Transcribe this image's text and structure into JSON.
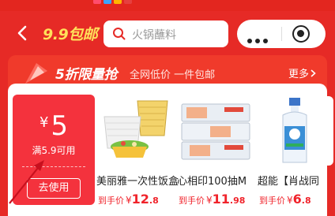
{
  "header": {
    "back_label": "返回",
    "title": "9.9包邮",
    "search_placeholder": "火锅蘸料"
  },
  "banner": {
    "title": "5折限量抢",
    "subtitle": "全网低价  一件包邮",
    "more_label": "更多"
  },
  "coupon": {
    "currency": "¥",
    "amount": "5",
    "condition": "满5.9可用",
    "action_label": "去使用"
  },
  "products": [
    {
      "name": "美丽雅一次性饭盒",
      "price_label": "到手价",
      "currency": "¥",
      "price_int": "12",
      "price_dec": ".8"
    },
    {
      "name": "心相印100抽M",
      "price_label": "到手价",
      "currency": "¥",
      "price_int": "11",
      "price_dec": ".98"
    },
    {
      "name": "超能【肖战同",
      "price_label": "到手价",
      "currency": "¥",
      "price_int": "6",
      "price_dec": ".8"
    }
  ],
  "colors": {
    "brand_red": "#e62a26",
    "coupon_red": "#f4323d",
    "price_red": "#f0232b",
    "title_yellow": "#ffe05a"
  },
  "icons": [
    "back-arrow-icon",
    "search-icon",
    "more-dots-icon",
    "close-target-icon",
    "chevron-right-icon",
    "hourglass-badge-icon"
  ]
}
